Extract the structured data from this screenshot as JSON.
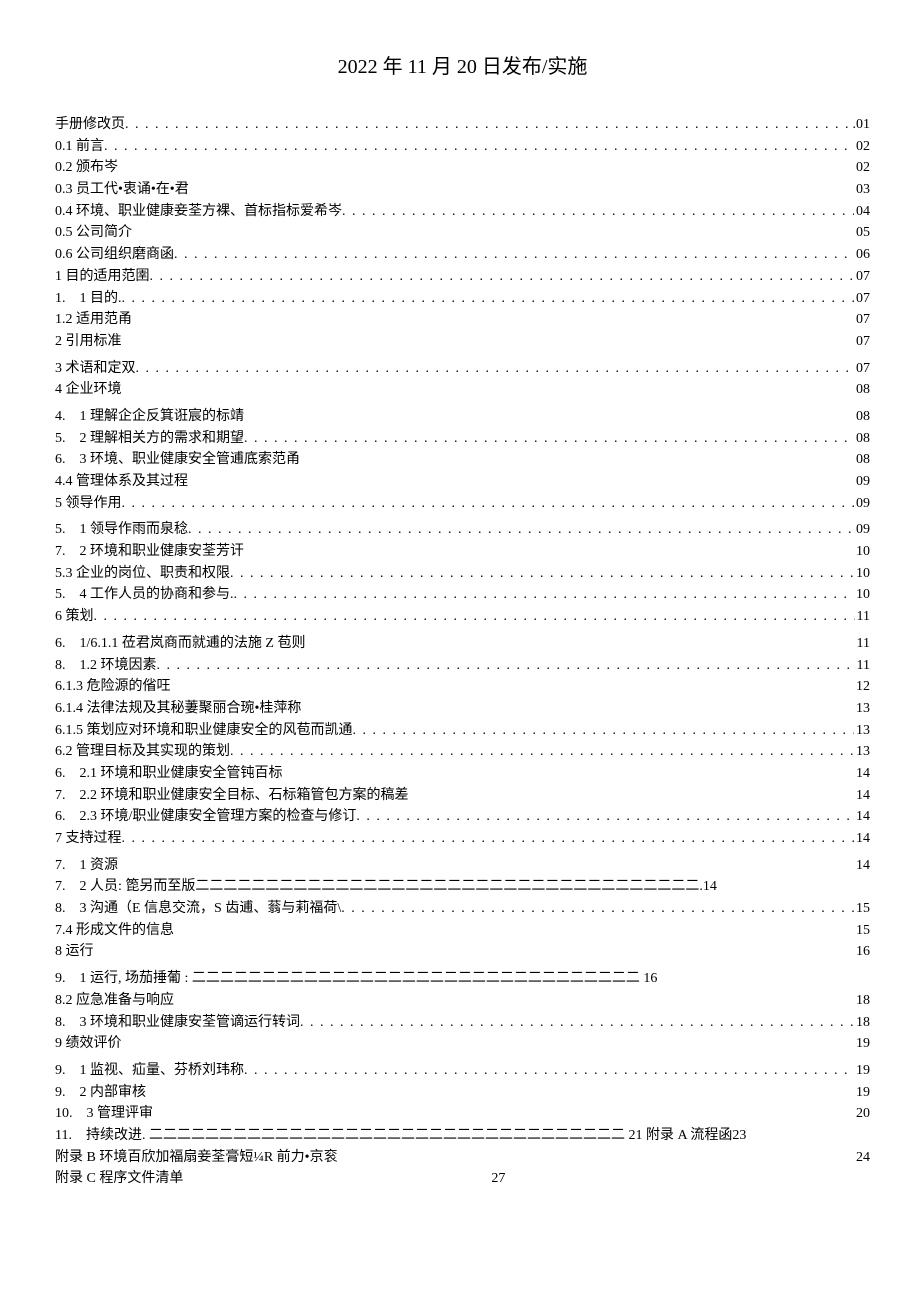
{
  "header": "2022 年 11 月 20 日发布/实施",
  "entries": [
    {
      "title": "手册修改页",
      "page": ".01",
      "dots": true
    },
    {
      "title": "0.1 前言",
      "page": "02",
      "dots": true
    },
    {
      "title": "0.2 颁布岑",
      "page": "02",
      "dots": false
    },
    {
      "title": "0.3 员工代•衷诵•在•君",
      "page": "03",
      "dots": false
    },
    {
      "title": "0.4 环境、职业健康妾荃方裸、首标指标爱希岑",
      "page": "04",
      "dots": true
    },
    {
      "title": "0.5 公司简介",
      "page": "05",
      "dots": false
    },
    {
      "title": "0.6 公司组织磨商函",
      "page": "06",
      "dots": true
    },
    {
      "title": "1 目的适用范圉",
      "page": "07",
      "dots": true
    },
    {
      "title": "1.　1 目的.",
      "page": "07",
      "dots": true
    },
    {
      "title": "1.2 适用范甬",
      "page": "07",
      "dots": false
    },
    {
      "title": "2 引用标准",
      "page": "07",
      "dots": false
    },
    {
      "spacer": true
    },
    {
      "title": "3 术语和定双",
      "page": "07",
      "dots": true
    },
    {
      "title": "4 企业环境",
      "page": "08",
      "dots": false
    },
    {
      "spacer": true
    },
    {
      "title": "4.　1 理解企企反箕诳宸的标靖",
      "page": "08",
      "dots": false
    },
    {
      "title": "5.　2 理解相关方的需求和期望",
      "page": "08",
      "dots": true
    },
    {
      "title": "6.　3 环境、职业健康安全管逋底索范甬",
      "page": "08",
      "dots": false
    },
    {
      "title": "4.4 管理体系及其过程",
      "page": "09",
      "dots": false
    },
    {
      "title": "5 领导作用",
      "page": "09",
      "dots": true
    },
    {
      "spacer": true
    },
    {
      "title": "5.　1 领导作雨而泉稔",
      "page": "09",
      "dots": true
    },
    {
      "title": "7.　2 环境和职业健康安荃芳讦",
      "page": "10",
      "dots": false
    },
    {
      "title": "5.3 企业的岗位、职责和权限",
      "page": "10",
      "dots": true
    },
    {
      "title": "5.　4 工作人员的协商和参与.",
      "page": "10",
      "dots": true
    },
    {
      "title": "6 策划",
      "page": "11",
      "dots": true
    },
    {
      "spacer": true
    },
    {
      "title": "6.　1/6.1.1 莅君岚商而就逋的法施 Z 苞则",
      "page": "11",
      "dots": false
    },
    {
      "title": "8.　1.2 环境因素",
      "page": "11",
      "dots": true
    },
    {
      "title": "6.1.3 危险源的偗㕵",
      "page": "12",
      "dots": false
    },
    {
      "title": "6.1.4 法律法规及其秘萋聚丽合琬•桂萍称",
      "page": "13",
      "dots": false
    },
    {
      "title": "6.1.5 策划应对环境和职业健康安全的风苞而凯通",
      "page": "13",
      "dots": true
    },
    {
      "title": "6.2 管理目标及其实现的策划",
      "page": "13",
      "dots": true
    },
    {
      "title": "6.　2.1 环境和职业健康安全管钝百标",
      "page": "14",
      "dots": false
    },
    {
      "title": "7.　2.2 环境和职业健康安全目标、石标箱管包方案的稿差",
      "page": "14",
      "dots": false
    },
    {
      "title": "6.　2.3 环境/职业健康安全管理方案的检查与修订",
      "page": "14",
      "dots": true
    },
    {
      "title": "7 支持过程",
      "page": "14",
      "dots": true
    },
    {
      "spacer": true
    },
    {
      "title": "7.　1 资源",
      "page": "14",
      "dots": false
    },
    {
      "title": "7.　2 人员: 箆另而至版二二二二二二二二二二二二二二二二二二二二二二二二二二二二二二二二二二二二.14",
      "page": "",
      "dots": false,
      "raw": true
    },
    {
      "title": "8.　3 沟通（E 信息交流，S 齿逋、蓊与莉福荷\\",
      "page": "15",
      "dots": true
    },
    {
      "title": "7.4 形成文件的信息",
      "page": "15",
      "dots": false
    },
    {
      "title": "8 运行",
      "page": "16",
      "dots": false
    },
    {
      "spacer": true
    },
    {
      "title": "9.　1 运行, 场茄捶葡 : 二二二二二二二二二二二二二二二二二二二二二二二二二二二二二二二二 16",
      "page": "",
      "dots": false,
      "raw": true
    },
    {
      "title": "8.2 应急准备与响应",
      "page": "18",
      "dots": false
    },
    {
      "title": "8.　3 环境和职业健康安荃管谪运行转词",
      "page": "18",
      "dots": true
    },
    {
      "title": "9 绩效评价",
      "page": "19",
      "dots": false
    },
    {
      "spacer": true
    },
    {
      "title": "9.　1 监视、疝量、芬桥刘玮称",
      "page": "19",
      "dots": true
    },
    {
      "title": "9.　2 内部审核",
      "page": "19",
      "dots": false
    },
    {
      "title": "10.　3 管理评审",
      "page": "20",
      "dots": false
    },
    {
      "title": "11.　持续改进. 二二二二二二二二二二二二二二二二二二二二二二二二二二二二二二二二二二 21 附录 A 流程函23",
      "page": "",
      "dots": false,
      "raw": true
    },
    {
      "title": "附录 B 环境百欣加福扇妾荃膏短¼R 前力•京衮",
      "page": "24",
      "dots": false
    },
    {
      "title": "附录 C 程序文件清单　　　　　　　　　　　　　　　　　　　　　　27",
      "page": "",
      "dots": false,
      "raw": true
    }
  ]
}
